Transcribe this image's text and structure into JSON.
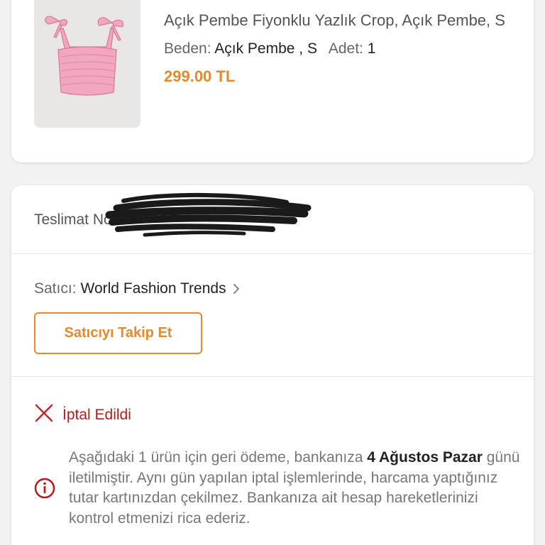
{
  "product": {
    "title": "Açık Pembe Fiyonklu Yazlık Crop, Açık Pembe, S",
    "size_label": "Beden:",
    "size_value": "Açık Pembe , S",
    "qty_label": "Adet:",
    "qty_value": "1",
    "price": "299.00 TL"
  },
  "delivery": {
    "label": "Teslimat No"
  },
  "seller": {
    "label": "Satıcı:",
    "name": "World Fashion Trends",
    "follow_button": "Satıcıyı Takip Et"
  },
  "status": {
    "text": "İptal Edildi",
    "icon": "x-icon"
  },
  "info": {
    "icon": "info-icon",
    "text_1": "Aşağıdaki 1 ürün için geri ödeme, bankanıza ",
    "date_1": "4 Ağustos",
    "date_2": "Pazar",
    "text_2": " günü iletilmiştir. Aynı gün yapılan iptal işlemlerinde, harcama yaptığınız tutar kartınızdan çekilmez. Bankanıza ait hesap hareketlerinizi kontrol etmenizi rica ederiz."
  },
  "colors": {
    "accent": "#e8892b",
    "cancel": "#b71c1c",
    "background": "#f2f2f2"
  }
}
